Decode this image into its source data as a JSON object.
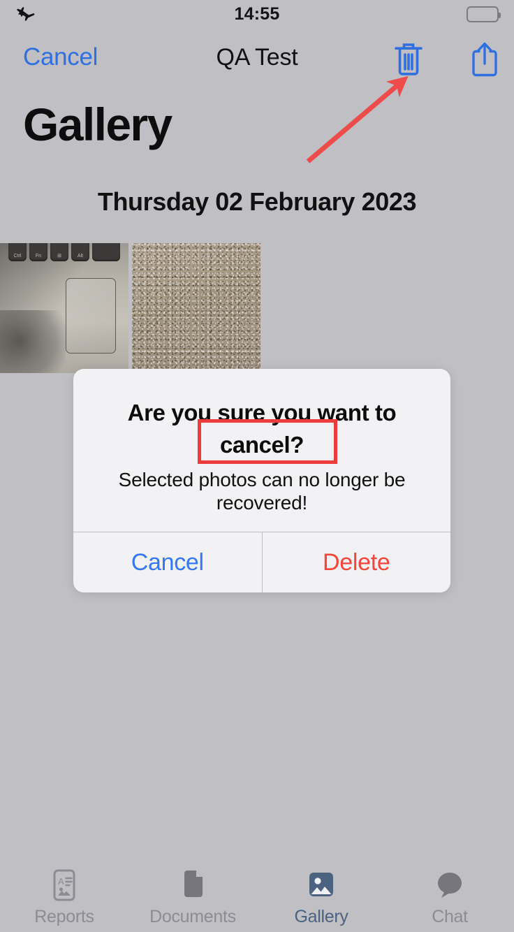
{
  "status_bar": {
    "airplane_icon": "airplane-mode-icon",
    "time": "14:55",
    "battery_icon": "battery-full-icon"
  },
  "nav_bar": {
    "cancel_label": "Cancel",
    "title": "QA Test",
    "trash_icon": "trash-icon",
    "share_icon": "share-icon",
    "accent_color": "#2f6fe0"
  },
  "page": {
    "large_title": "Gallery",
    "date_header": "Thursday 02 February 2023"
  },
  "photo_grid": {
    "items": [
      {
        "name": "photo-laptop-keyboard",
        "keys": [
          "Ctrl",
          "Fn",
          "⊞",
          "Alt",
          ""
        ]
      },
      {
        "name": "photo-carpet-texture"
      }
    ]
  },
  "alert": {
    "title": "Are you sure you want to cancel?",
    "message": "Selected photos can no longer be recovered!",
    "cancel_label": "Cancel",
    "delete_label": "Delete",
    "cancel_color": "#3478f6",
    "delete_color": "#f8453a"
  },
  "tab_bar": {
    "items": [
      {
        "label": "Reports",
        "icon": "reports-icon",
        "active": false
      },
      {
        "label": "Documents",
        "icon": "documents-icon",
        "active": false
      },
      {
        "label": "Gallery",
        "icon": "gallery-icon",
        "active": true
      },
      {
        "label": "Chat",
        "icon": "chat-icon",
        "active": false
      }
    ],
    "active_color": "#4b6281",
    "inactive_color": "#8c8c93"
  },
  "annotations": {
    "arrow_color": "#ee4b4b",
    "box_color": "#ee3b3b",
    "arrow_target": "trash-icon",
    "box_target": "alert-title"
  }
}
